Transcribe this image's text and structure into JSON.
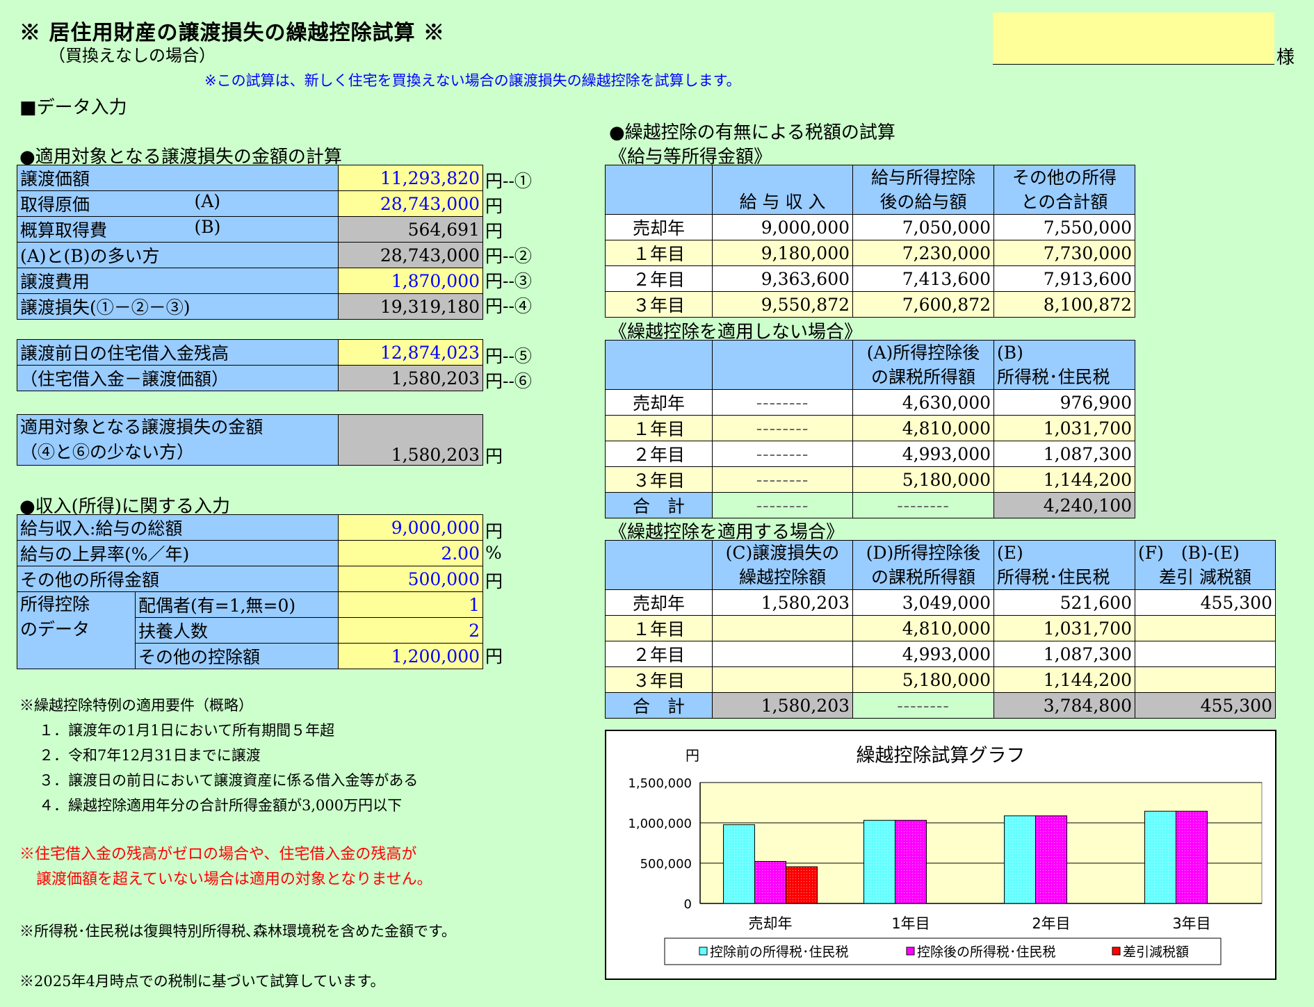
{
  "header": {
    "title": "※ 居住用財産の譲渡損失の繰越控除試算 ※",
    "subtitle": "（買換えなしの場合）",
    "note": "※この試算は、新しく住宅を買換えない場合の譲渡損失の繰越控除を試算します。",
    "name_value": "",
    "honorific": "様"
  },
  "data_input_heading": "■データ入力",
  "loss_calc": {
    "heading": "●適用対象となる譲渡損失の金額の計算",
    "rows": [
      {
        "label": "譲渡価額",
        "value": "11,293,820",
        "unit": "円--①"
      },
      {
        "label": "取得原価",
        "tag": "(A)",
        "value": "28,743,000",
        "unit": "円"
      },
      {
        "label": "概算取得費",
        "tag": "(B)",
        "value": "564,691",
        "unit": "円"
      },
      {
        "label": "(A)と(B)の多い方",
        "value": "28,743,000",
        "unit": "円--②"
      },
      {
        "label": "譲渡費用",
        "value": "1,870,000",
        "unit": "円--③"
      },
      {
        "label": "譲渡損失(①－②－③)",
        "value": "19,319,180",
        "unit": "円--④"
      }
    ],
    "loan_rows": [
      {
        "label": "譲渡前日の住宅借入金残高",
        "value": "12,874,023",
        "unit": "円--⑤"
      },
      {
        "label": "（住宅借入金－譲渡価額）",
        "value": "1,580,203",
        "unit": "円--⑥"
      }
    ],
    "applicable": {
      "label1": "適用対象となる譲渡損失の金額",
      "label2": "（④と⑥の少ない方）",
      "value": "1,580,203",
      "unit": "円"
    }
  },
  "income_input": {
    "heading": "●収入(所得)に関する入力",
    "rows": [
      {
        "label": "給与収入:給与の総額",
        "value": "9,000,000",
        "unit": "円"
      },
      {
        "label": "給与の上昇率(%／年)",
        "value": "2.00",
        "unit": "%"
      },
      {
        "label": "その他の所得金額",
        "value": "500,000",
        "unit": "円"
      }
    ],
    "deduction_group_label1": "所得控除",
    "deduction_group_label2": "のデータ",
    "deductions": [
      {
        "label": "配偶者(有=1,無=0)",
        "value": "1",
        "unit": ""
      },
      {
        "label": "扶養人数",
        "value": "2",
        "unit": ""
      },
      {
        "label": "その他の控除額",
        "value": "1,200,000",
        "unit": "円"
      }
    ]
  },
  "requirements": {
    "heading": "※繰越控除特例の適用要件（概略）",
    "items": [
      "１．譲渡年の1月1日において所有期間５年超",
      "２．令和7年12月31日までに譲渡",
      "３．譲渡日の前日において譲渡資産に係る借入金等がある",
      "４．繰越控除適用年分の合計所得金額が3,000万円以下"
    ],
    "warning1": "※住宅借入金の残高がゼロの場合や、住宅借入金の残高が",
    "warning2": "譲渡価額を超えていない場合は適用の対象となりません。",
    "note_tax": "※所得税･住民税は復興特別所得税､森林環境税を含めた金額です。",
    "note_date": "※2025年4月時点での税制に基づいて試算しています。"
  },
  "tax_calc": {
    "heading": "●繰越控除の有無による税額の試算",
    "salary": {
      "heading": "《給与等所得金額》",
      "col1": "給 与 収 入",
      "col2a": "給与所得控除",
      "col2b": "後の給与額",
      "col3a": "その他の所得",
      "col3b": "との合計額",
      "rows": [
        {
          "year": "売却年",
          "v1": "9,000,000",
          "v2": "7,050,000",
          "v3": "7,550,000"
        },
        {
          "year": "１年目",
          "v1": "9,180,000",
          "v2": "7,230,000",
          "v3": "7,730,000"
        },
        {
          "year": "２年目",
          "v1": "9,363,600",
          "v2": "7,413,600",
          "v3": "7,913,600"
        },
        {
          "year": "３年目",
          "v1": "9,550,872",
          "v2": "7,600,872",
          "v3": "8,100,872"
        }
      ]
    },
    "no_carry": {
      "heading": "《繰越控除を適用しない場合》",
      "colAa": "(A)所得控除後",
      "colAb": "の課税所得額",
      "colBa": "(B)",
      "colBb": "所得税･住民税",
      "dash": "--------",
      "rows": [
        {
          "year": "売却年",
          "a": "4,630,000",
          "b": "976,900"
        },
        {
          "year": "１年目",
          "a": "4,810,000",
          "b": "1,031,700"
        },
        {
          "year": "２年目",
          "a": "4,993,000",
          "b": "1,087,300"
        },
        {
          "year": "３年目",
          "a": "5,180,000",
          "b": "1,144,200"
        }
      ],
      "total_label": "合　計",
      "total_b": "4,240,100"
    },
    "with_carry": {
      "heading": "《繰越控除を適用する場合》",
      "colCa": "(C)譲渡損失の",
      "colCb": "繰越控除額",
      "colDa": "(D)所得控除後",
      "colDb": "の課税所得額",
      "colEa": "(E)",
      "colEb": "所得税･住民税",
      "colFa": "(F)　(B)-(E)",
      "colFb": "差引 減税額",
      "rows": [
        {
          "year": "売却年",
          "c": "1,580,203",
          "d": "3,049,000",
          "e": "521,600",
          "f": "455,300"
        },
        {
          "year": "１年目",
          "c": "",
          "d": "4,810,000",
          "e": "1,031,700",
          "f": ""
        },
        {
          "year": "２年目",
          "c": "",
          "d": "4,993,000",
          "e": "1,087,300",
          "f": ""
        },
        {
          "year": "３年目",
          "c": "",
          "d": "5,180,000",
          "e": "1,144,200",
          "f": ""
        }
      ],
      "total_label": "合　計",
      "total_c": "1,580,203",
      "dash": "--------",
      "total_e": "3,784,800",
      "total_f": "455,300"
    }
  },
  "chart_data": {
    "type": "bar",
    "title": "繰越控除試算グラフ",
    "ylabel": "円",
    "categories": [
      "売却年",
      "1年目",
      "2年目",
      "3年目"
    ],
    "ylim": [
      0,
      1500000
    ],
    "yticks": [
      "0",
      "500,000",
      "1,000,000",
      "1,500,000"
    ],
    "ytick_values": [
      0,
      500000,
      1000000,
      1500000
    ],
    "series": [
      {
        "name": "控除前の所得税･住民税",
        "color": "#66ffff",
        "values": [
          976900,
          1031700,
          1087300,
          1144200
        ]
      },
      {
        "name": "控除後の所得税･住民税",
        "color": "#ff00ff",
        "values": [
          521600,
          1031700,
          1087300,
          1144200
        ]
      },
      {
        "name": "差引減税額",
        "color": "#ff0000",
        "values": [
          455300,
          0,
          0,
          0
        ]
      }
    ],
    "legend": "bottom",
    "plot_background": "#ffffcc"
  }
}
